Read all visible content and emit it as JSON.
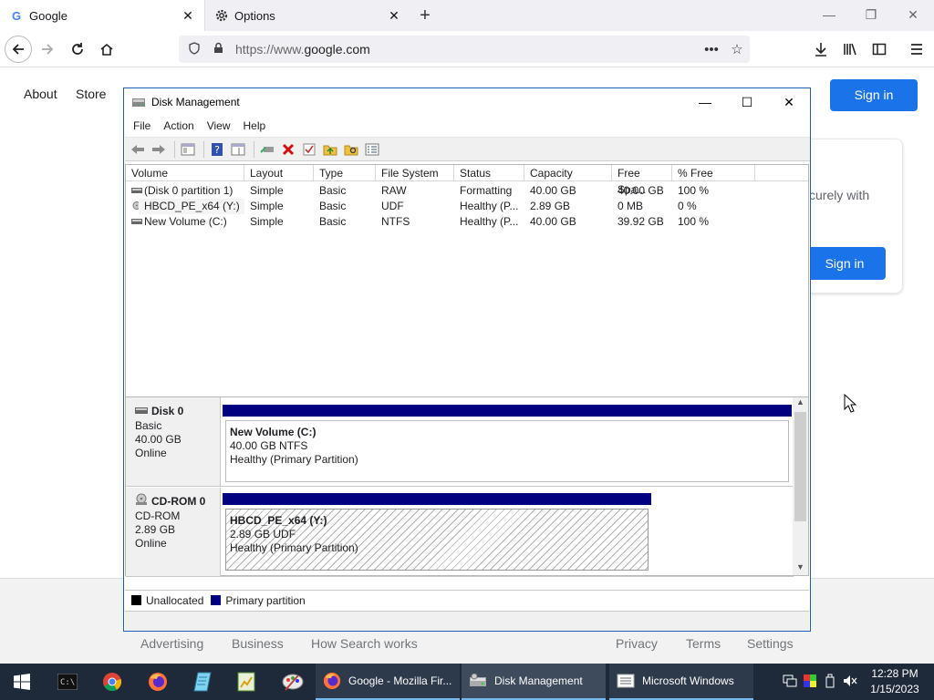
{
  "browser": {
    "tabs": [
      {
        "title": "Google",
        "icon": "google-g-icon"
      },
      {
        "title": "Options",
        "icon": "gear-icon"
      }
    ],
    "url_prefix": "https://www.",
    "url_domain": "google.com",
    "url_full": "https://www.google.com"
  },
  "google": {
    "top_links": [
      "About",
      "Store"
    ],
    "sign_in_top": "Sign in",
    "card_text": "curely with",
    "card_sign_in": "Sign in",
    "footer_links": [
      "Advertising",
      "Business",
      "How Search works",
      "Privacy",
      "Terms",
      "Settings"
    ]
  },
  "disk_management": {
    "title": "Disk Management",
    "menu": [
      "File",
      "Action",
      "View",
      "Help"
    ],
    "columns": [
      "Volume",
      "Layout",
      "Type",
      "File System",
      "Status",
      "Capacity",
      "Free Spa...",
      "% Free"
    ],
    "volumes": [
      {
        "volume": "(Disk 0 partition 1)",
        "layout": "Simple",
        "type": "Basic",
        "fs": "RAW",
        "status": "Formatting",
        "capacity": "40.00 GB",
        "free": "40.00 GB",
        "pct": "100 %",
        "kind": "disk"
      },
      {
        "volume": "HBCD_PE_x64 (Y:)",
        "layout": "Simple",
        "type": "Basic",
        "fs": "UDF",
        "status": "Healthy (P...",
        "capacity": "2.89 GB",
        "free": "0 MB",
        "pct": "0 %",
        "kind": "cdrom"
      },
      {
        "volume": "New Volume (C:)",
        "layout": "Simple",
        "type": "Basic",
        "fs": "NTFS",
        "status": "Healthy (P...",
        "capacity": "40.00 GB",
        "free": "39.92 GB",
        "pct": "100 %",
        "kind": "disk"
      }
    ],
    "disks": [
      {
        "name": "Disk 0",
        "type": "Basic",
        "size": "40.00 GB",
        "state": "Online",
        "partition": {
          "name": "New Volume  (C:)",
          "size_fs": "40.00 GB NTFS",
          "status": "Healthy (Primary Partition)"
        }
      },
      {
        "name": "CD-ROM 0",
        "type": "CD-ROM",
        "size": "2.89 GB",
        "state": "Online",
        "partition": {
          "name": "HBCD_PE_x64  (Y:)",
          "size_fs": "2.89 GB UDF",
          "status": "Healthy (Primary Partition)"
        }
      }
    ],
    "legend": [
      {
        "label": "Unallocated",
        "color": "#000000"
      },
      {
        "label": "Primary partition",
        "color": "#000080"
      }
    ]
  },
  "taskbar": {
    "tasks": [
      {
        "label": "Google - Mozilla Fir...",
        "icon": "firefox-icon"
      },
      {
        "label": "Disk Management",
        "icon": "disk-management-icon"
      },
      {
        "label": "Microsoft Windows",
        "icon": "window-list-icon"
      }
    ],
    "time": "12:28 PM",
    "date": "1/15/2023"
  },
  "colors": {
    "accent": "#1a73e8",
    "partition_bar": "#000080",
    "taskbar": "#1e2a3a"
  }
}
